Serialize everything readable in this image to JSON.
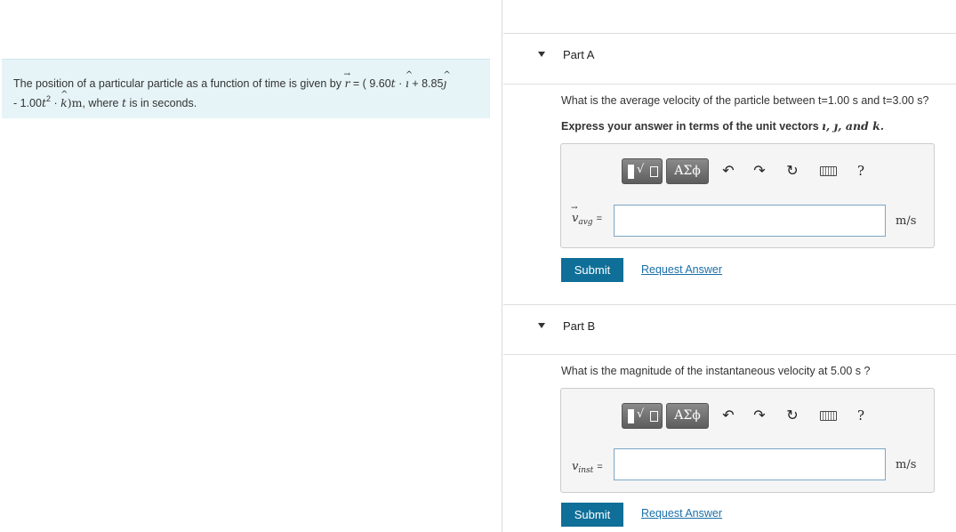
{
  "problem": {
    "intro": "The position of a particular particle as a function of time is given by",
    "r_symbol": "r",
    "eq_open": "= ( 9.60",
    "t1": "t",
    "dot1": "·",
    "i_unit": "ı",
    "plus": "+ 8.85",
    "j_unit": "ȷ",
    "line2_prefix": "- 1.00",
    "t2": "t",
    "exp": "2",
    "dot2": "·",
    "k_unit": "k",
    "close_unit": ")m",
    "where": ", where",
    "t3": "t",
    "tail": "is in seconds."
  },
  "part_a": {
    "title": "Part A",
    "question": "What is the average velocity of the particle between t=1.00 s and t=3.00 s?",
    "express_prefix": "Express your answer in terms of the unit vectors",
    "express_units": "ı, ȷ, and k.",
    "var_symbol": "v",
    "var_sub": "avg",
    "eq_sign": "=",
    "answer_value": "",
    "units": "m/s",
    "submit_label": "Submit",
    "request_label": "Request Answer"
  },
  "part_b": {
    "title": "Part B",
    "question": "What is the magnitude of the instantaneous velocity at 5.00 s ?",
    "var_symbol": "v",
    "var_sub": "inst",
    "eq_sign": "=",
    "answer_value": "",
    "units": "m/s",
    "submit_label": "Submit",
    "request_label": "Request Answer"
  },
  "toolbar": {
    "greek_label": "ΑΣϕ",
    "undo_icon": "undo-icon",
    "redo_icon": "redo-icon",
    "reset_icon": "reset-icon",
    "keyboard_icon": "keyboard-icon",
    "help_label": "?"
  },
  "colors": {
    "problem_bg": "#e6f4f7",
    "submit_bg": "#0f6f98",
    "link": "#1a6fa8"
  }
}
